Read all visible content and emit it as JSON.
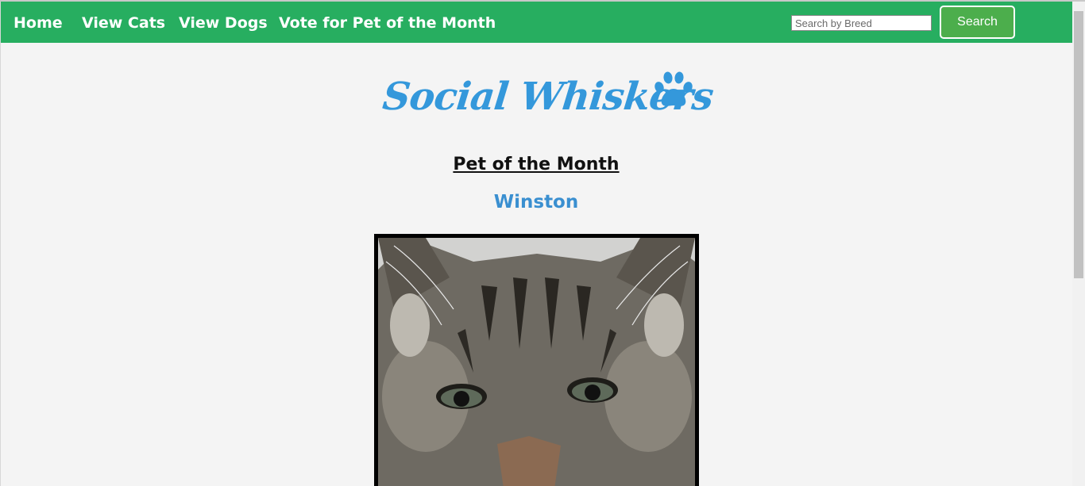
{
  "nav": {
    "items": [
      {
        "label": "Home"
      },
      {
        "label": "View Cats"
      },
      {
        "label": "View Dogs"
      },
      {
        "label": "Vote for Pet of the Month"
      }
    ],
    "search": {
      "placeholder": "Search by Breed",
      "button_label": "Search"
    }
  },
  "brand": {
    "name": "Social Whiskers",
    "icon": "paw-icon"
  },
  "main": {
    "section_title": "Pet of the Month",
    "pet_name": "Winston",
    "photo": "tabby-cat-photo"
  },
  "colors": {
    "nav_bg": "#27ae60",
    "brand": "#3498db",
    "pet_name": "#3a8fd0",
    "search_button": "#4cae4c"
  }
}
